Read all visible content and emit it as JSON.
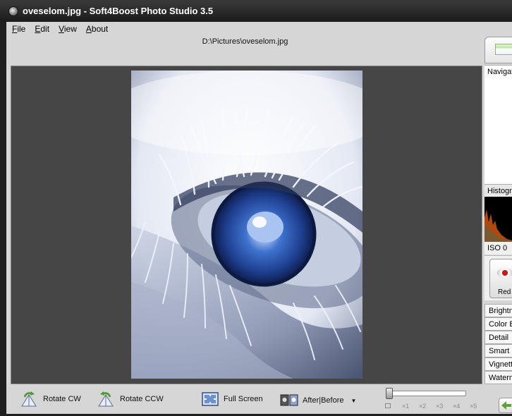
{
  "window": {
    "title": "oveselom.jpg  -  Soft4Boost Photo Studio 3.5"
  },
  "menu": {
    "items": [
      "File",
      "Edit",
      "View",
      "About"
    ]
  },
  "file_path": "D:\\Pictures\\oveselom.jpg",
  "toolbar": {
    "rotate_cw": "Rotate CW",
    "rotate_ccw": "Rotate CCW",
    "full_screen": "Full Screen",
    "after_before": "After|Before",
    "zoom_marks": [
      "×1",
      "×2",
      "×3",
      "×4",
      "×5"
    ]
  },
  "right_panel": {
    "navigator": "Navigator",
    "histogram": "Histogram",
    "iso": "ISO 0",
    "red_eye": "Red",
    "adjustments": [
      "Brightness",
      "Color B",
      "Detail",
      "Smart",
      "Vignette",
      "Watermark"
    ]
  },
  "colors": {
    "accent_blue": "#2d5fb8",
    "canvas_bg": "#464646",
    "panel_bg": "#d6d6d6"
  }
}
